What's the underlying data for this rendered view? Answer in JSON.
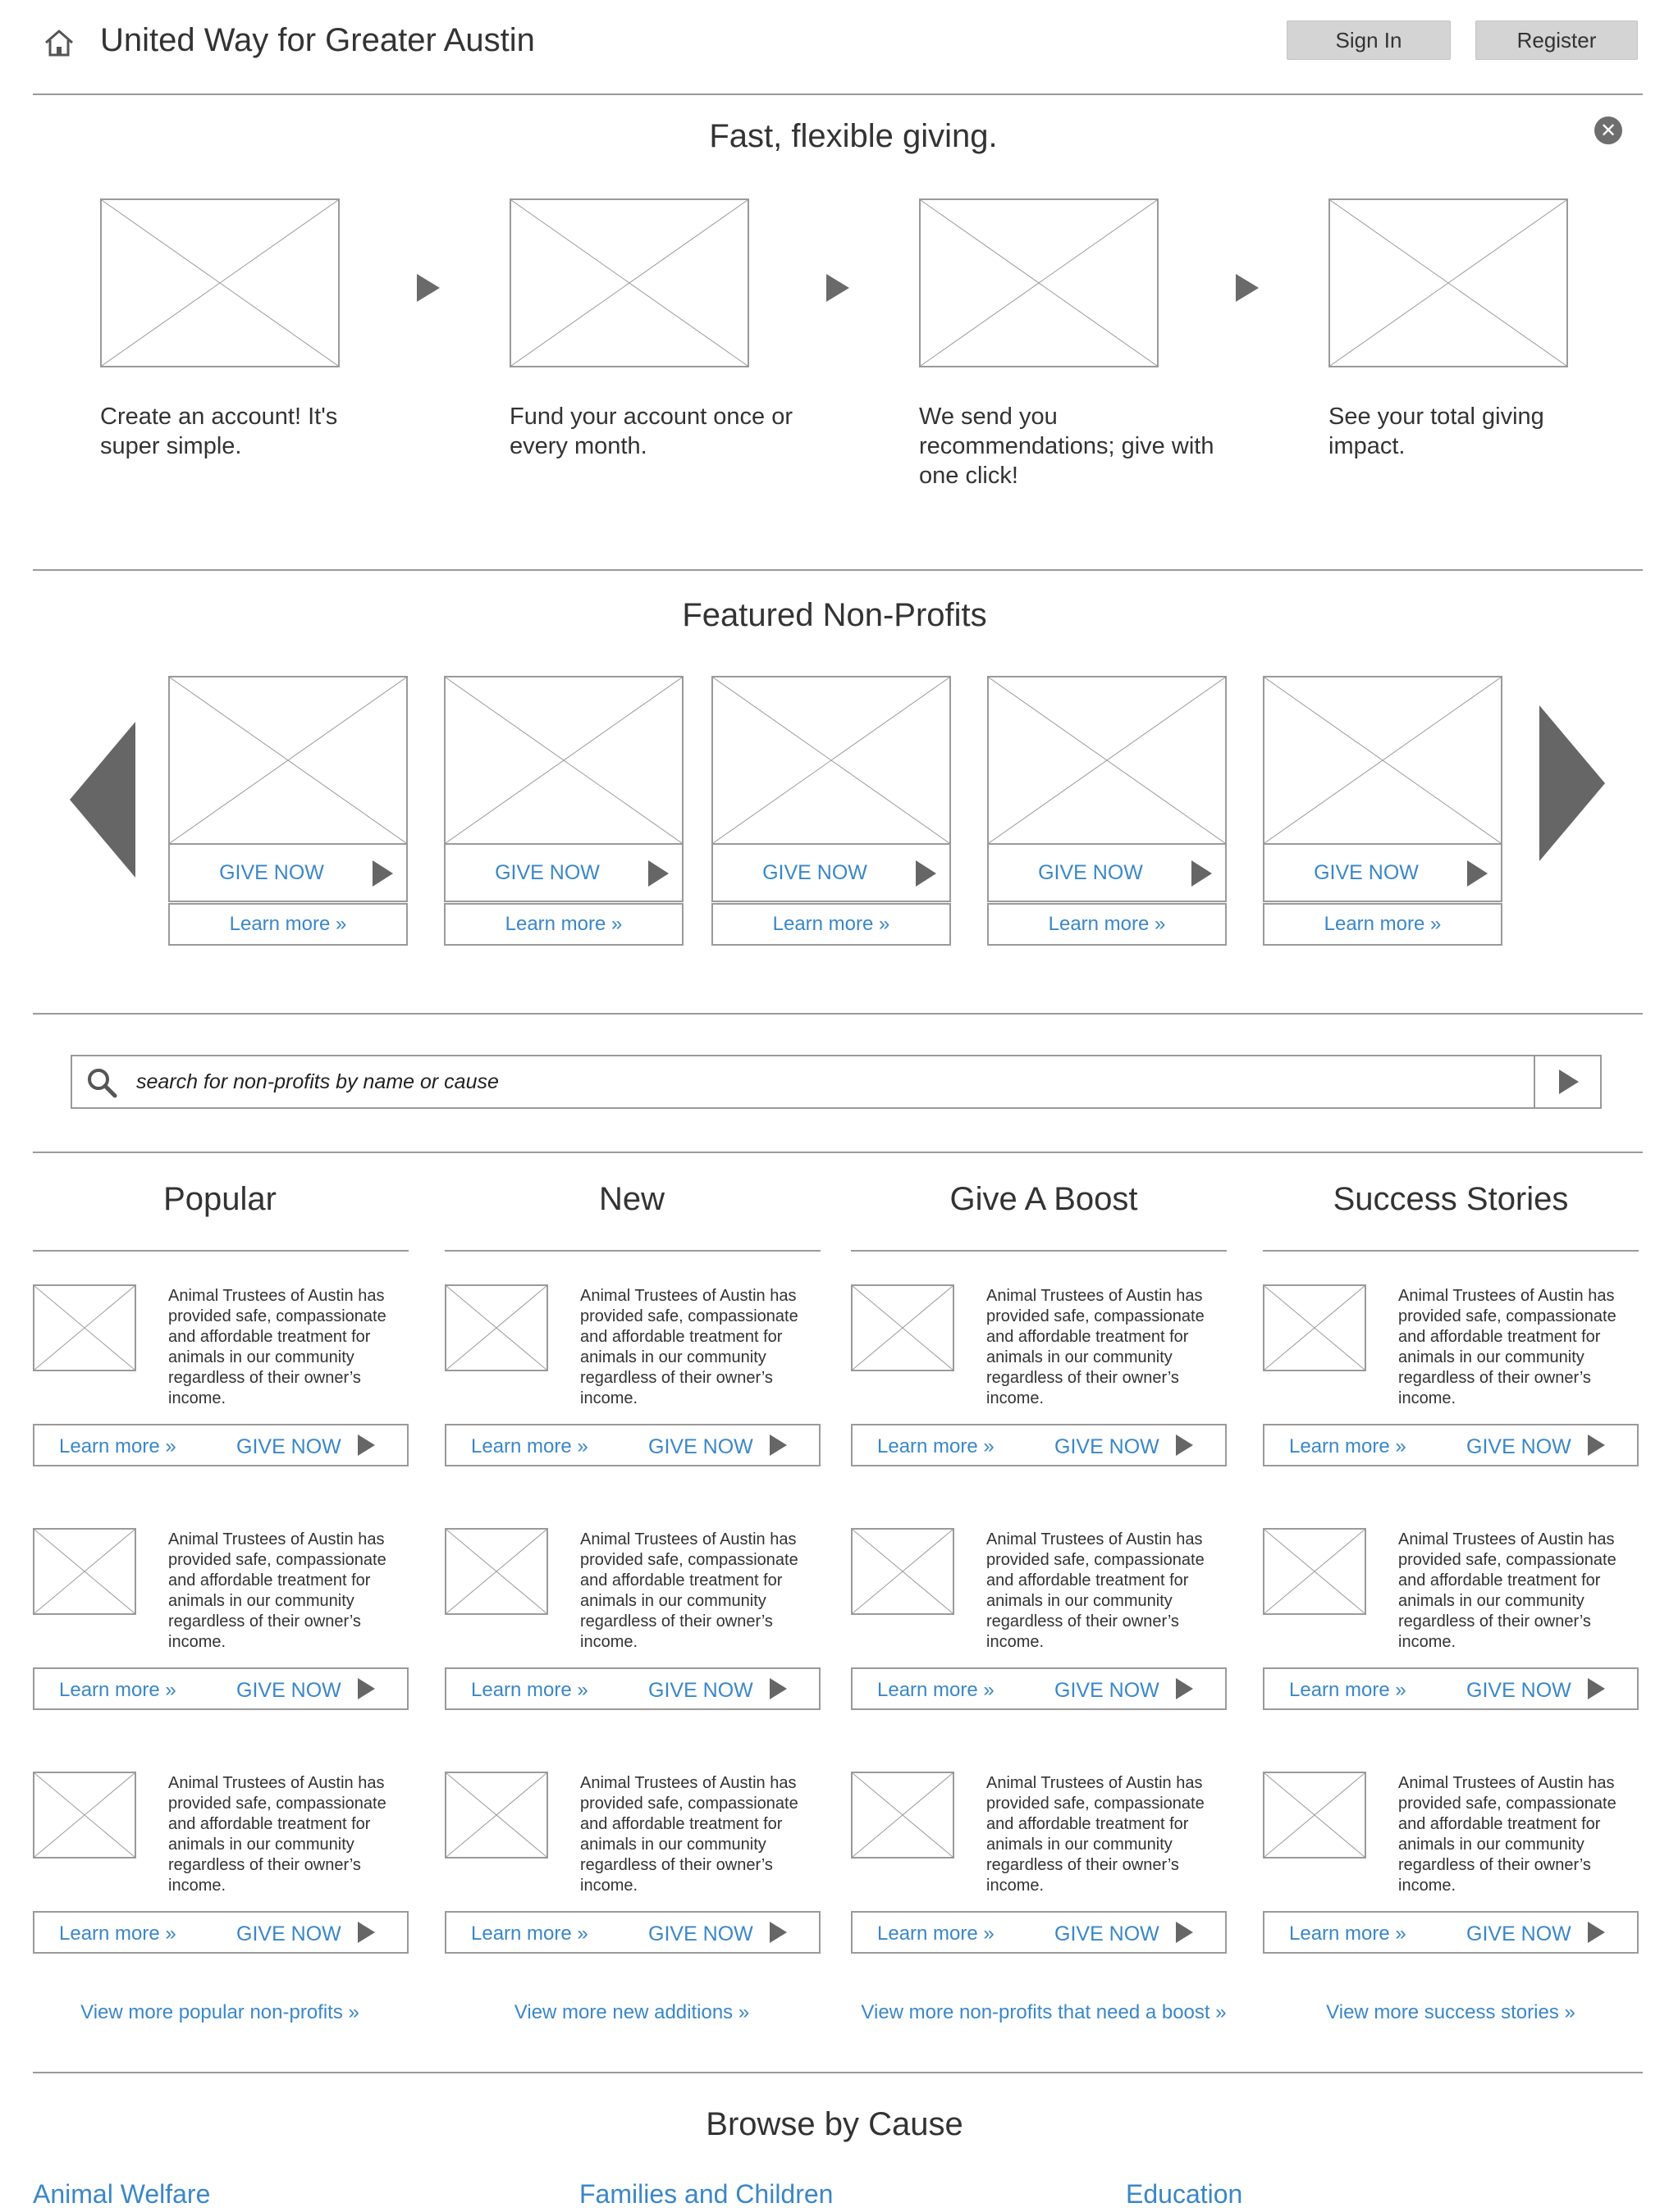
{
  "header": {
    "title": "United Way for Greater Austin",
    "sign_in": "Sign In",
    "register": "Register",
    "home_icon": "home-icon"
  },
  "hero": {
    "title": "Fast, flexible giving.",
    "close_symbol": "✕",
    "steps": [
      {
        "text": "Create an account! It's super simple."
      },
      {
        "text": "Fund your account once or every month."
      },
      {
        "text": "We send you recommendations; give with one click!"
      },
      {
        "text": "See your total giving impact."
      }
    ]
  },
  "featured": {
    "title": "Featured Non-Profits",
    "cards": [
      {
        "give": "GIVE NOW",
        "learn": "Learn more »"
      },
      {
        "give": "GIVE NOW",
        "learn": "Learn more »"
      },
      {
        "give": "GIVE NOW",
        "learn": "Learn more »"
      },
      {
        "give": "GIVE NOW",
        "learn": "Learn more »"
      },
      {
        "give": "GIVE NOW",
        "learn": "Learn more »"
      }
    ]
  },
  "search": {
    "placeholder": "search for non-profits by name or cause"
  },
  "columns": [
    {
      "title": "Popular",
      "view_more": "View more popular non-profits »",
      "items": [
        {
          "text": "Animal Trustees of Austin has provided safe, compassionate and affordable treatment for animals in our community regardless of their owner’s income.",
          "learn": "Learn more »",
          "give": "GIVE NOW"
        },
        {
          "text": "Animal Trustees of Austin has provided safe, compassionate and affordable treatment for animals in our community regardless of their owner’s income.",
          "learn": "Learn more »",
          "give": "GIVE NOW"
        },
        {
          "text": "Animal Trustees of Austin has provided safe, compassionate and affordable treatment for animals in our community regardless of their owner’s income.",
          "learn": "Learn more »",
          "give": "GIVE NOW"
        }
      ]
    },
    {
      "title": "New",
      "view_more": "View more new additions »",
      "items": [
        {
          "text": "Animal Trustees of Austin has provided safe, compassionate and affordable treatment for animals in our community regardless of their owner’s income.",
          "learn": "Learn more »",
          "give": "GIVE NOW"
        },
        {
          "text": "Animal Trustees of Austin has provided safe, compassionate and affordable treatment for animals in our community regardless of their owner’s income.",
          "learn": "Learn more »",
          "give": "GIVE NOW"
        },
        {
          "text": "Animal Trustees of Austin has provided safe, compassionate and affordable treatment for animals in our community regardless of their owner’s income.",
          "learn": "Learn more »",
          "give": "GIVE NOW"
        }
      ]
    },
    {
      "title": "Give A Boost",
      "view_more": "View more non-profits that need a boost »",
      "items": [
        {
          "text": "Animal Trustees of Austin has provided safe, compassionate and affordable treatment for animals in our community regardless of their owner’s income.",
          "learn": "Learn more »",
          "give": "GIVE NOW"
        },
        {
          "text": "Animal Trustees of Austin has provided safe, compassionate and affordable treatment for animals in our community regardless of their owner’s income.",
          "learn": "Learn more »",
          "give": "GIVE NOW"
        },
        {
          "text": "Animal Trustees of Austin has provided safe, compassionate and affordable treatment for animals in our community regardless of their owner’s income.",
          "learn": "Learn more »",
          "give": "GIVE NOW"
        }
      ]
    },
    {
      "title": "Success Stories",
      "view_more": "View more success stories »",
      "items": [
        {
          "text": "Animal Trustees of Austin has provided safe, compassionate and affordable treatment for animals in our community regardless of their owner’s income.",
          "learn": "Learn more »",
          "give": "GIVE NOW"
        },
        {
          "text": "Animal Trustees of Austin has provided safe, compassionate and affordable treatment for animals in our community regardless of their owner’s income.",
          "learn": "Learn more »",
          "give": "GIVE NOW"
        },
        {
          "text": "Animal Trustees of Austin has provided safe, compassionate and affordable treatment for animals in our community regardless of their owner’s income.",
          "learn": "Learn more »",
          "give": "GIVE NOW"
        }
      ]
    }
  ],
  "browse": {
    "title": "Browse by Cause",
    "causes": [
      "Animal Welfare",
      "Families and Children",
      "Education"
    ]
  },
  "colors": {
    "link": "#3a87c8",
    "rule": "#9a9a9a",
    "icon": "#666666"
  }
}
